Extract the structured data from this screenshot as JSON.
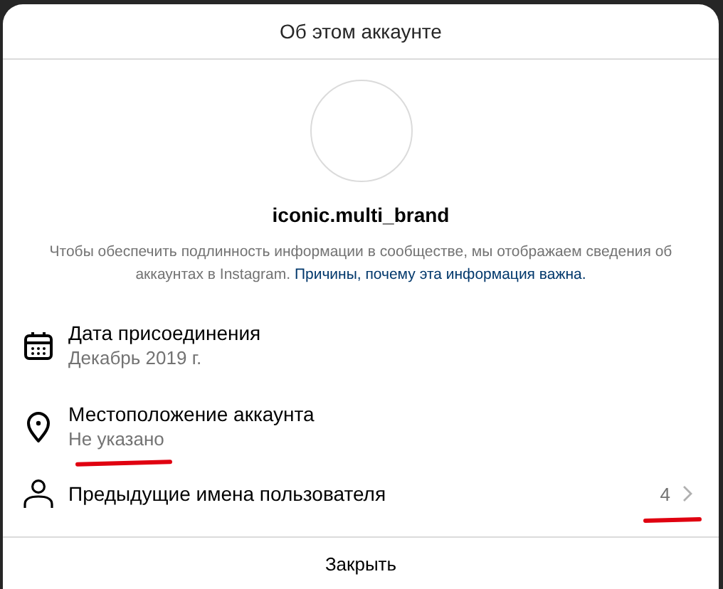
{
  "dialog": {
    "title": "Об этом аккаунте"
  },
  "profile": {
    "username": "iconic.multi_brand",
    "description": "Чтобы обеспечить подлинность информации в сообществе, мы отображаем сведения об аккаунтах в Instagram.",
    "link": "Причины, почему эта информация важна."
  },
  "rows": [
    {
      "kind": "date",
      "title": "Дата присоединения",
      "subtitle": "Декабрь 2019 г."
    },
    {
      "kind": "location",
      "title": "Местоположение аккаунта",
      "subtitle": "Не указано",
      "subtitle_underlined": true
    },
    {
      "kind": "usernames",
      "title": "Предыдущие имена пользователя",
      "count": "4",
      "count_underlined": true
    }
  ],
  "close_button": "Закрыть"
}
